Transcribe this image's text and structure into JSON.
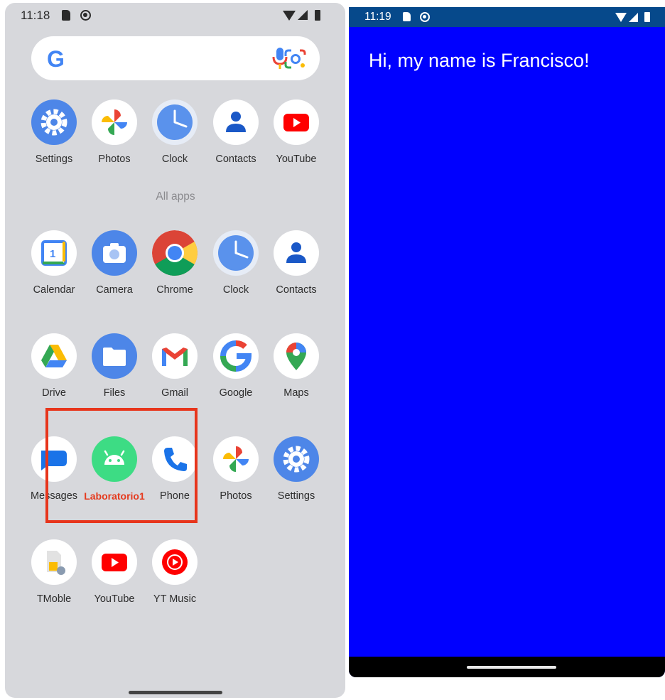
{
  "left_screen": {
    "status_time": "11:18",
    "favorites": [
      "Settings",
      "Photos",
      "Clock",
      "Contacts",
      "YouTube"
    ],
    "all_apps_label": "All apps",
    "apps": [
      "Calendar",
      "Camera",
      "Chrome",
      "Clock",
      "Contacts",
      "Drive",
      "Files",
      "Gmail",
      "Google",
      "Maps",
      "Messages",
      "Laboratorio1",
      "Phone",
      "Photos",
      "Settings",
      "TMoble",
      "YouTube",
      "YT Music"
    ]
  },
  "right_screen": {
    "status_time": "11:19",
    "greeting": "Hi, my name is Francisco!",
    "background_color": "#0000ff",
    "status_bar_color": "#06498b"
  },
  "highlight_color": "#e7351c"
}
